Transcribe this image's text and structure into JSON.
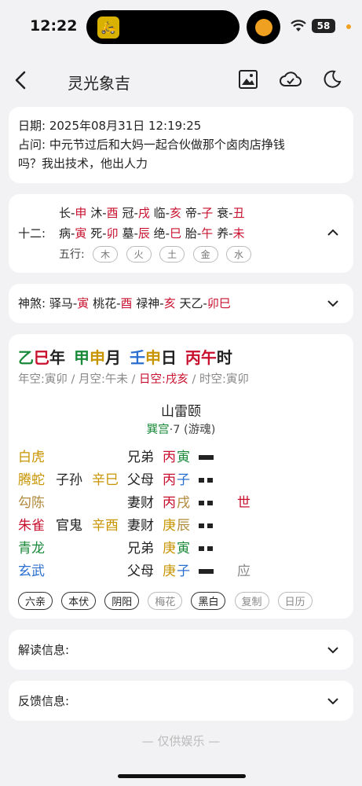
{
  "status": {
    "time": "12:22",
    "battery": "58"
  },
  "nav": {
    "title": "灵光象吉"
  },
  "info": {
    "date_label": "日期:",
    "date_value": "2025年08月31日 12:19:25",
    "question_label": "占问:",
    "question_line1": "中元节过后和大妈一起合伙做那个卤肉店挣钱",
    "question_line2": "吗？我出技术，他出人力"
  },
  "twelve": {
    "label": "十二:",
    "row1": [
      {
        "a": "长-",
        "b": "申"
      },
      {
        "a": "沐-",
        "b": "酉"
      },
      {
        "a": "冠-",
        "b": "戌"
      },
      {
        "a": "临-",
        "b": "亥"
      },
      {
        "a": "帝-",
        "b": "子"
      },
      {
        "a": "衰-",
        "b": "丑"
      }
    ],
    "row2": [
      {
        "a": "病-",
        "b": "寅"
      },
      {
        "a": "死-",
        "b": "卯"
      },
      {
        "a": "墓-",
        "b": "辰"
      },
      {
        "a": "绝-",
        "b": "巳"
      },
      {
        "a": "胎-",
        "b": "午"
      },
      {
        "a": "养-",
        "b": "未"
      }
    ],
    "wuxing_label": "五行:",
    "wuxing": [
      "木",
      "火",
      "土",
      "金",
      "水"
    ]
  },
  "shensha": {
    "label": "神煞:",
    "items": [
      {
        "a": "驿马-",
        "b": "寅"
      },
      {
        "a": "桃花-",
        "b": "酉"
      },
      {
        "a": "禄神-",
        "b": "亥"
      },
      {
        "a": "天乙-",
        "b": "卯巳"
      }
    ]
  },
  "pillars": {
    "p1a": "乙",
    "p1b": "巳",
    "p1c": "年",
    "p2a": "甲",
    "p2b": "申",
    "p2c": "月",
    "p3a": "壬",
    "p3b": "申",
    "p3c": "日",
    "p4a": "丙",
    "p4b": "午",
    "p4c": "时",
    "kong_year": "年空:寅卯",
    "kong_month": "月空:午未",
    "kong_day": "日空:戌亥",
    "kong_hour": "时空:寅卯",
    "sep": "/"
  },
  "gua": {
    "name": "山雷颐",
    "palace": "巽宫",
    "sub": "·7 (游魂)"
  },
  "lines": [
    {
      "god": "白虎",
      "fu_rel": "",
      "fu_gz": "",
      "rel": "兄弟",
      "gz1": "丙",
      "gz2": "寅",
      "type": "yang",
      "mark": ""
    },
    {
      "god": "腾蛇",
      "fu_rel": "子孙",
      "fu_gz": "辛巳",
      "rel": "父母",
      "gz1": "丙",
      "gz2": "子",
      "type": "yin",
      "mark": ""
    },
    {
      "god": "勾陈",
      "fu_rel": "",
      "fu_gz": "",
      "rel": "妻财",
      "gz1": "丙",
      "gz2": "戌",
      "type": "yin",
      "mark": "世"
    },
    {
      "god": "朱雀",
      "fu_rel": "官鬼",
      "fu_gz": "辛酉",
      "rel": "妻财",
      "gz1": "庚",
      "gz2": "辰",
      "type": "yin",
      "mark": ""
    },
    {
      "god": "青龙",
      "fu_rel": "",
      "fu_gz": "",
      "rel": "兄弟",
      "gz1": "庚",
      "gz2": "寅",
      "type": "yin",
      "mark": ""
    },
    {
      "god": "玄武",
      "fu_rel": "",
      "fu_gz": "",
      "rel": "父母",
      "gz1": "庚",
      "gz2": "子",
      "type": "yang",
      "mark": "应"
    }
  ],
  "toggles": [
    "六亲",
    "本伏",
    "阴阳",
    "梅花",
    "黑白",
    "复制",
    "日历"
  ],
  "sections": {
    "jiedu": "解读信息:",
    "fankui": "反馈信息:"
  },
  "footer": "— 仅供娱乐 —",
  "colors": {
    "red": "#c8102e",
    "green": "#1a8a3a",
    "gold": "#c89400",
    "blue": "#2a6fd0"
  }
}
